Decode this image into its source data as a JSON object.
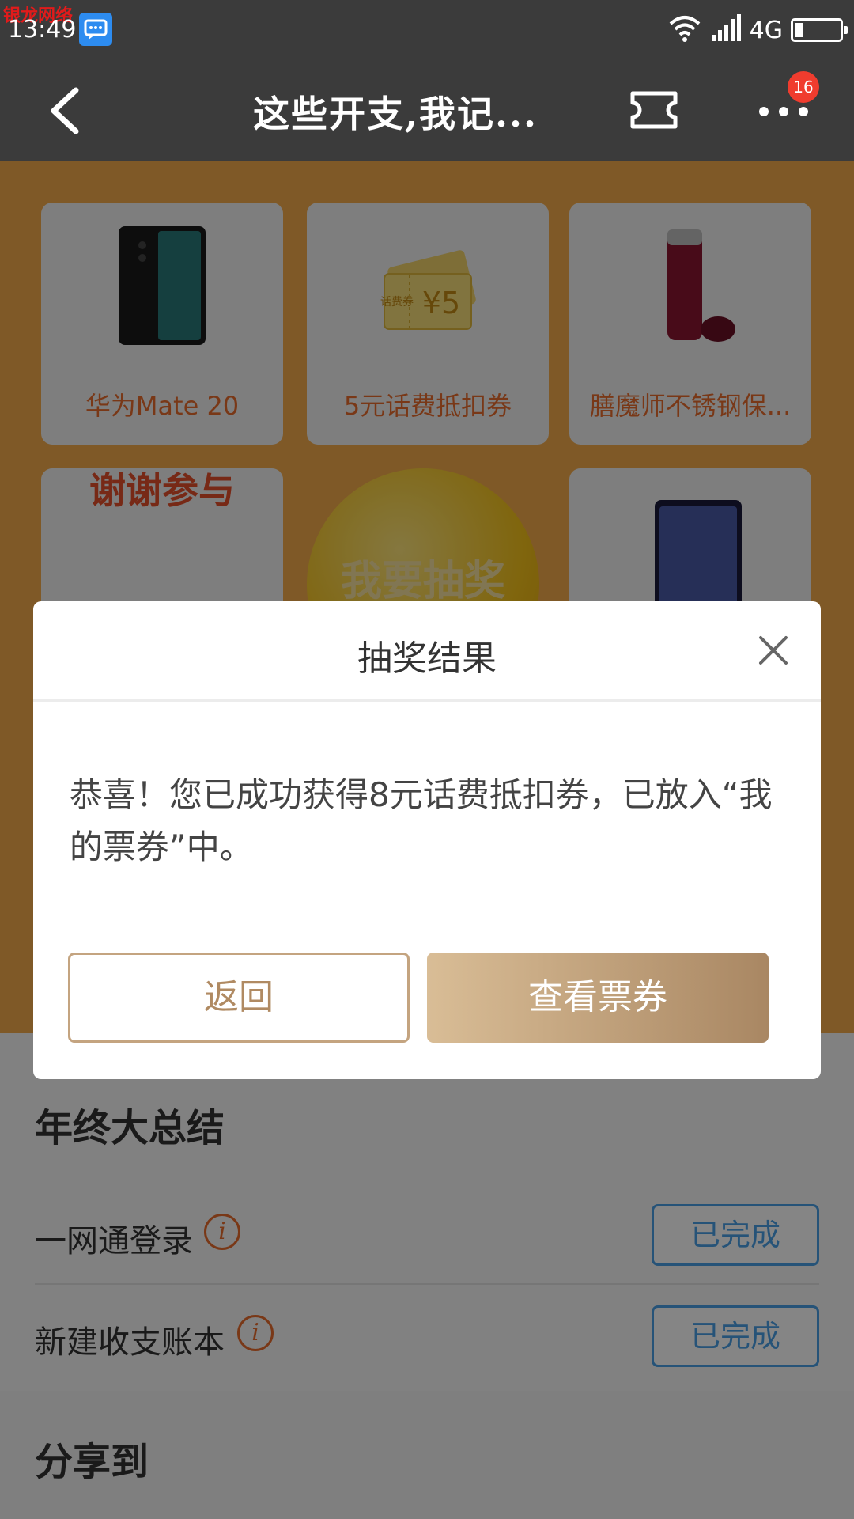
{
  "status_bar": {
    "watermark": "银龙网络",
    "time": "13:49",
    "network": "4G"
  },
  "nav": {
    "title": "这些开支,我记...",
    "badge_count": "16"
  },
  "prizes": [
    {
      "label": "华为Mate 20",
      "icon": "phone-icon"
    },
    {
      "label": "5元话费抵扣券",
      "icon": "coupon-icon"
    },
    {
      "label": "膳魔师不锈钢保...",
      "icon": "thermos-icon"
    }
  ],
  "coupon_value": "¥5",
  "coupon_tag": "话费券",
  "thanks_label": "谢谢参与",
  "draw_button": "我要抽奖",
  "summary": {
    "title": "年终大总结",
    "tasks": [
      {
        "label": "一网通登录",
        "status": "已完成"
      },
      {
        "label": "新建收支账本",
        "status": "已完成"
      }
    ],
    "share_title": "分享到"
  },
  "dialog": {
    "title": "抽奖结果",
    "message": "恭喜！您已成功获得8元话费抵扣券，已放入“我的票券”中。",
    "back_label": "返回",
    "view_label": "查看票券"
  },
  "colors": {
    "accent": "#e86c2c",
    "done_blue": "#4aa0e6",
    "gold": "#b08a62",
    "lottery_bg": "#f4ab4c"
  }
}
